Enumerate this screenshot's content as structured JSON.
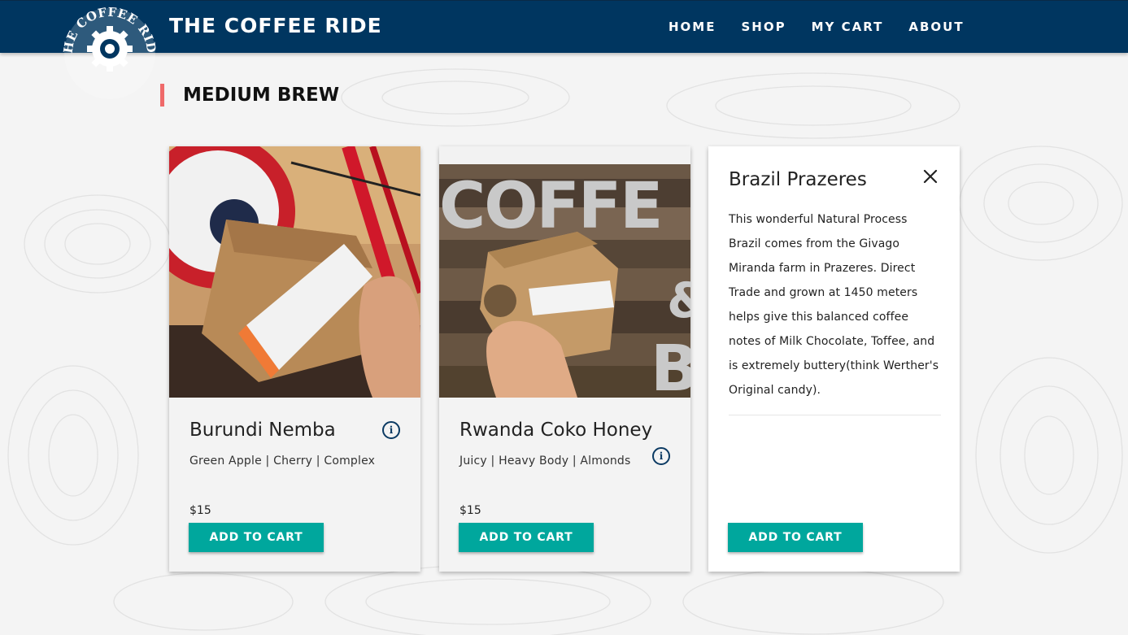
{
  "header": {
    "brand": "THE COFFEE RIDE",
    "logo_text": "THE COFFEE RIDE",
    "nav": [
      "HOME",
      "SHOP",
      "MY CART",
      "ABOUT"
    ]
  },
  "section": {
    "title": "MEDIUM BREW"
  },
  "products": [
    {
      "name": "Burundi Nemba",
      "notes": "Green Apple | Cherry | Complex",
      "price": "$15",
      "button": "ADD TO CART",
      "info_icon": "info-icon"
    },
    {
      "name": "Rwanda Coko Honey",
      "notes": "Juicy | Heavy Body | Almonds",
      "price": "$15",
      "button": "ADD TO CART",
      "info_icon": "info-icon"
    }
  ],
  "detail": {
    "title": "Brazil Prazeres",
    "description": "This wonderful Natural Process Brazil comes from the Givago Miranda farm in Prazeres. Direct Trade and grown at 1450 meters helps give this balanced coffee notes of Milk Chocolate, Toffee, and is extremely buttery(think Werther's Original candy).",
    "button": "ADD TO CART",
    "close_icon": "close-icon"
  },
  "colors": {
    "header_bg": "#003660",
    "accent_bar": "#ef6a6a",
    "button": "#00a79d",
    "info_icon": "#0b3a63"
  }
}
